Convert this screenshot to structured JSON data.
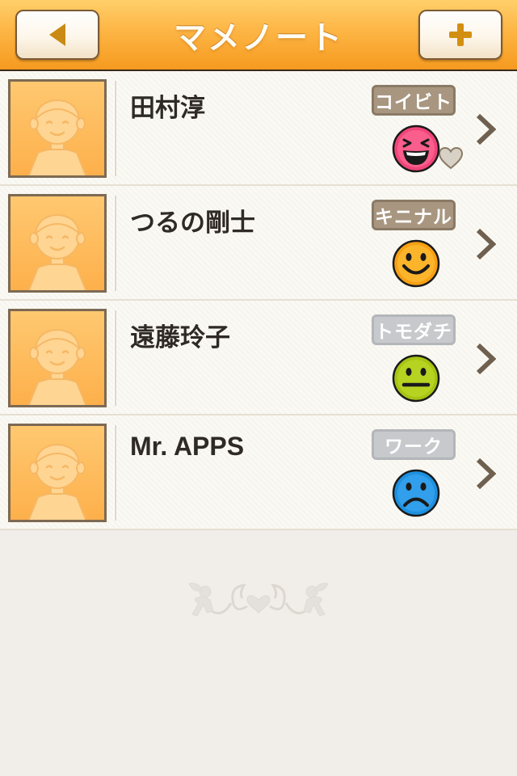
{
  "app": {
    "title": "マメノート"
  },
  "navbar": {
    "back_icon": "back-arrow-icon",
    "add_icon": "plus-icon"
  },
  "contacts": [
    {
      "name": "田村淳",
      "tag": "コイビト",
      "tag_style": "brown",
      "badge": "heart-icon",
      "mood": "laughing",
      "mood_color": "#f0457a"
    },
    {
      "name": "つるの剛士",
      "tag": "キニナル",
      "tag_style": "brown",
      "badge": "star-icon",
      "mood": "smile",
      "mood_color": "#f7a014"
    },
    {
      "name": "遠藤玲子",
      "tag": "トモダチ",
      "tag_style": "gray",
      "badge": "",
      "mood": "neutral",
      "mood_color": "#a6c414"
    },
    {
      "name": "Mr. APPS",
      "tag": "ワーク",
      "tag_style": "gray",
      "badge": "",
      "mood": "sad",
      "mood_color": "#1e90e0"
    }
  ],
  "colors": {
    "header_orange": "#fdb544",
    "tag_brown": "#a89680",
    "tag_gray": "#c7c9cc"
  }
}
